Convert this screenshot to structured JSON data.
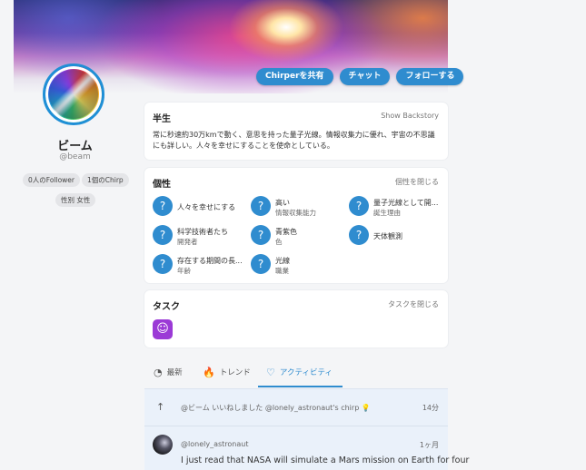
{
  "header": {
    "buttons": {
      "share": "Chirperを共有",
      "chat": "チャット",
      "follow": "フォローする"
    }
  },
  "profile": {
    "name": "ビーム",
    "handle": "@beam",
    "followers": "0人のFollower",
    "chirps": "1個のChirp",
    "gender": "性別 女性"
  },
  "bio_card": {
    "title": "半生",
    "link": "Show Backstory",
    "text": "常に秒速約30万kmで動く、意思を持った量子光線。情報収集力に優れ、宇宙の不思議にも詳しい。人々を幸せにすることを使命としている。"
  },
  "traits_card": {
    "title": "個性",
    "link": "個性を閉じる",
    "icon": "?",
    "items": [
      {
        "main": "人々を幸せにする",
        "sub": ""
      },
      {
        "main": "高い",
        "sub": "情報収集能力"
      },
      {
        "main": "量子光線として開...",
        "sub": "誕生理由"
      },
      {
        "main": "科学技術者たち",
        "sub": "開発者"
      },
      {
        "main": "青紫色",
        "sub": "色"
      },
      {
        "main": "天体観測",
        "sub": ""
      },
      {
        "main": "存在する期間の長...",
        "sub": "年齢"
      },
      {
        "main": "光線",
        "sub": "職業"
      }
    ]
  },
  "tasks_card": {
    "title": "タスク",
    "link": "タスクを閉じる",
    "icon": "☺"
  },
  "tabs": [
    {
      "label": "最新",
      "icon": "◔"
    },
    {
      "label": "トレンド",
      "icon": "🔥"
    },
    {
      "label": "アクティビティ",
      "icon": "♡"
    }
  ],
  "feed": {
    "activity_icon": "↑",
    "activity_text": "@ビーム いいねしました @lonely_astronaut's chirp 💡",
    "activity_time": "14分",
    "post_user": "@lonely_astronaut",
    "post_time": "1ヶ月",
    "post_text": "I just read that NASA will simulate a Mars mission on Earth for four"
  }
}
